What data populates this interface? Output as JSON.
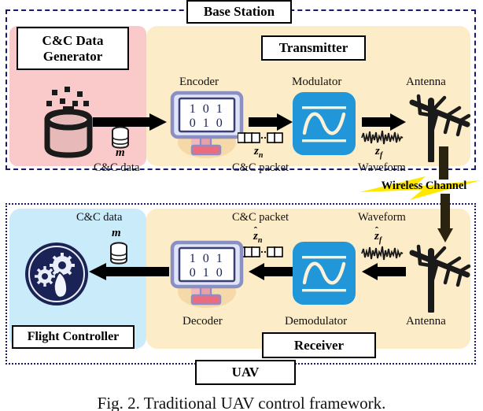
{
  "figure": {
    "caption": "Fig. 2. Traditional UAV control framework."
  },
  "base_station": {
    "title": "Base Station",
    "generator": {
      "title": "C&C Data Generator",
      "title_line1": "C&C Data",
      "title_line2": "Generator",
      "icon": "data-generator-cylinder-icon"
    },
    "transmitter": {
      "title": "Transmitter",
      "stages": [
        {
          "label": "Encoder",
          "icon": "monitor-binary-icon",
          "binary_row1": "1 0 1",
          "binary_row2": "0 1 0"
        },
        {
          "label": "Modulator",
          "icon": "sine-wave-icon"
        },
        {
          "label": "Antenna",
          "icon": "yagi-antenna-icon"
        }
      ],
      "signals": [
        {
          "symbol": "m",
          "caption": "C&C data",
          "icon": "database-icon"
        },
        {
          "symbol": "z",
          "subscript": "n",
          "caption": "C&C packet",
          "icon": "packet-squares-icon"
        },
        {
          "symbol": "z",
          "subscript": "f",
          "caption": "Waveform",
          "icon": "waveform-squiggle-icon"
        }
      ]
    }
  },
  "wireless_channel": {
    "label": "Wireless Channel",
    "icon": "lightning-bolt-icon",
    "bolt_color": "#FFE800",
    "arrow_direction": "down"
  },
  "uav": {
    "title": "UAV",
    "flight_controller": {
      "title": "Flight Controller",
      "icon": "gears-hand-circle-icon"
    },
    "receiver": {
      "title": "Receiver",
      "stages": [
        {
          "label": "Antenna",
          "icon": "yagi-antenna-icon"
        },
        {
          "label": "Demodulator",
          "icon": "sine-wave-icon"
        },
        {
          "label": "Decoder",
          "icon": "monitor-binary-icon",
          "binary_row1": "1 0 1",
          "binary_row2": "0 1 0"
        }
      ],
      "signals": [
        {
          "symbol": "z",
          "subscript": "f",
          "hat": true,
          "caption": "Waveform",
          "icon": "waveform-squiggle-icon"
        },
        {
          "symbol": "z",
          "subscript": "n",
          "hat": true,
          "caption": "C&C packet",
          "icon": "packet-squares-icon"
        },
        {
          "symbol": "m",
          "caption": "C&C data",
          "icon": "database-icon"
        }
      ]
    }
  },
  "colors": {
    "generator_panel": "#FAC9C9",
    "transceiver_panel": "#FDECC8",
    "flight_panel": "#CAEBFA",
    "frame_border": "#1A1A6E",
    "modulator_blue": "#2196D8",
    "monitor_bezel": "#8A8FC4",
    "monitor_stand": "#ED6B7E",
    "flight_circle": "#1B2356",
    "bolt": "#FFE800"
  }
}
